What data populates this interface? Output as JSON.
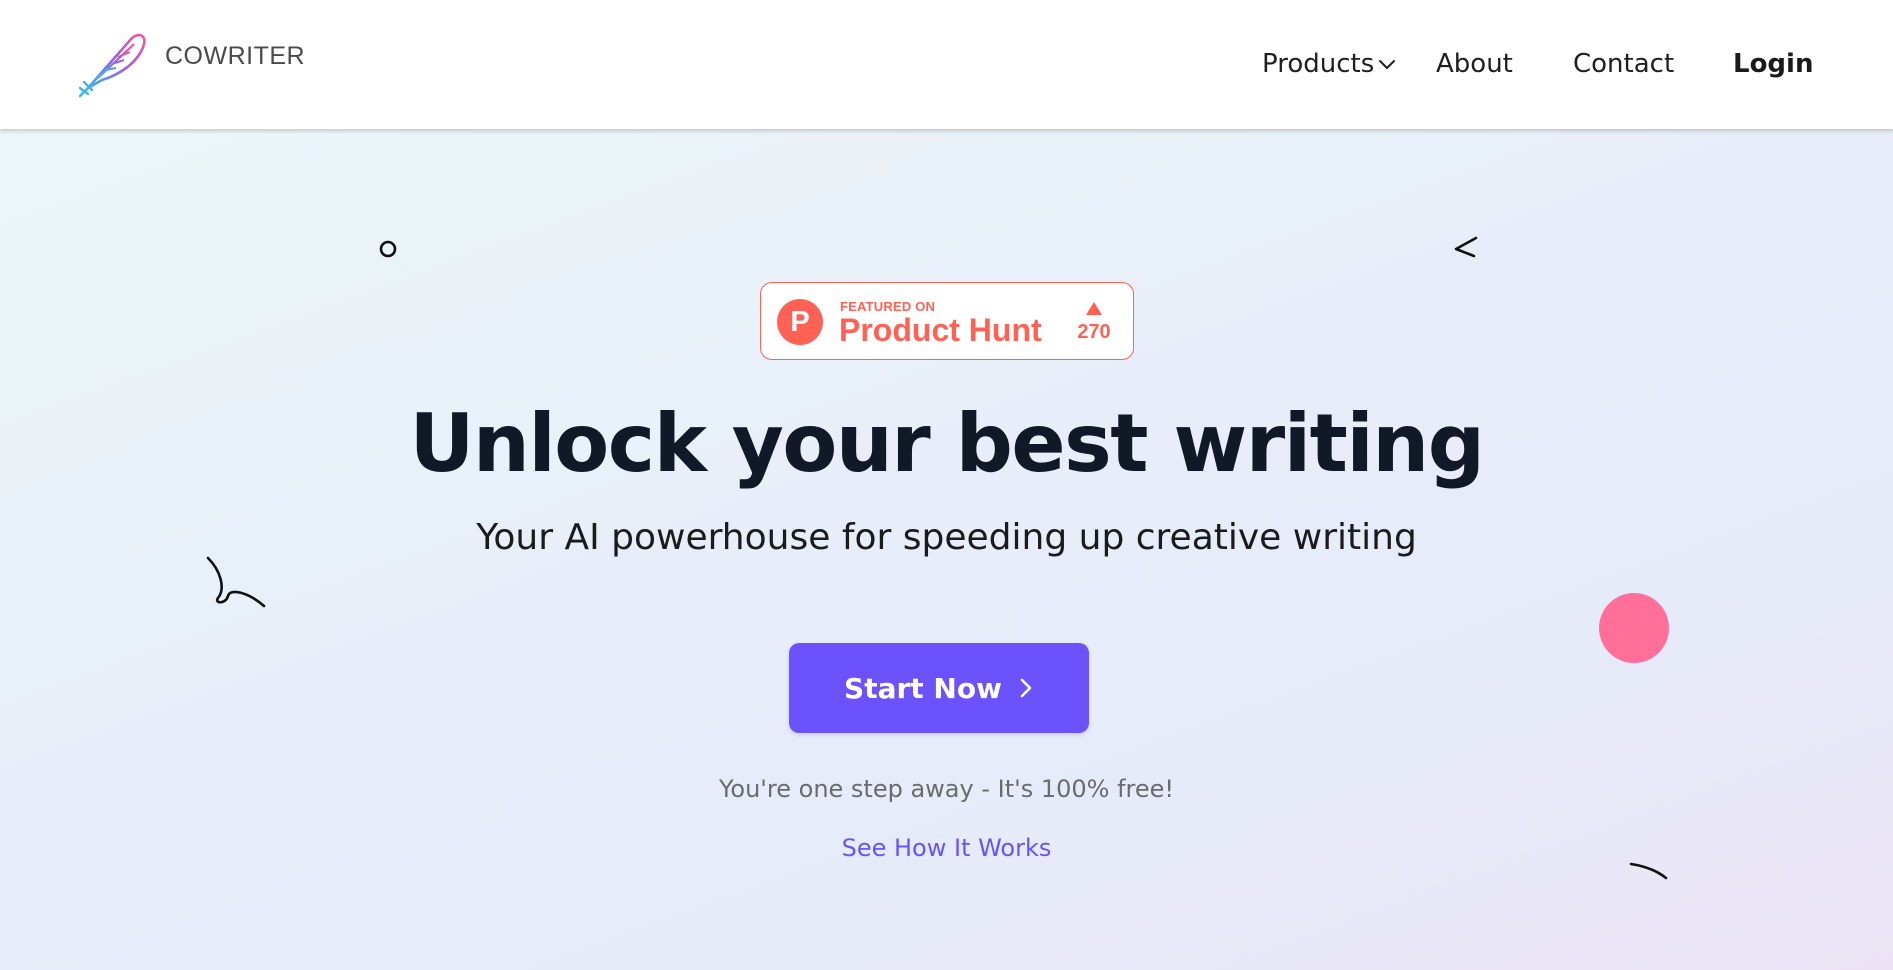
{
  "header": {
    "brand": "COWRITER",
    "nav": {
      "products": "Products",
      "about": "About",
      "contact": "Contact",
      "login": "Login"
    }
  },
  "badge": {
    "featured": "FEATURED ON",
    "name": "Product Hunt",
    "letter": "P",
    "votes": "270"
  },
  "hero": {
    "headline": "Unlock your best writing",
    "subhead": "Your AI powerhouse for speeding up creative writing",
    "cta": "Start Now",
    "note": "You're one step away - It's 100% free!",
    "secondary_link": "See How It Works"
  },
  "colors": {
    "accent": "#6c52fb",
    "product_hunt": "#ff6154",
    "pink_dot": "#ff6f9a",
    "headline": "#111827"
  },
  "icons": {
    "logo": "feather-quill-icon",
    "products_dropdown": "chevron-down-icon",
    "cta": "chevron-right-icon"
  }
}
